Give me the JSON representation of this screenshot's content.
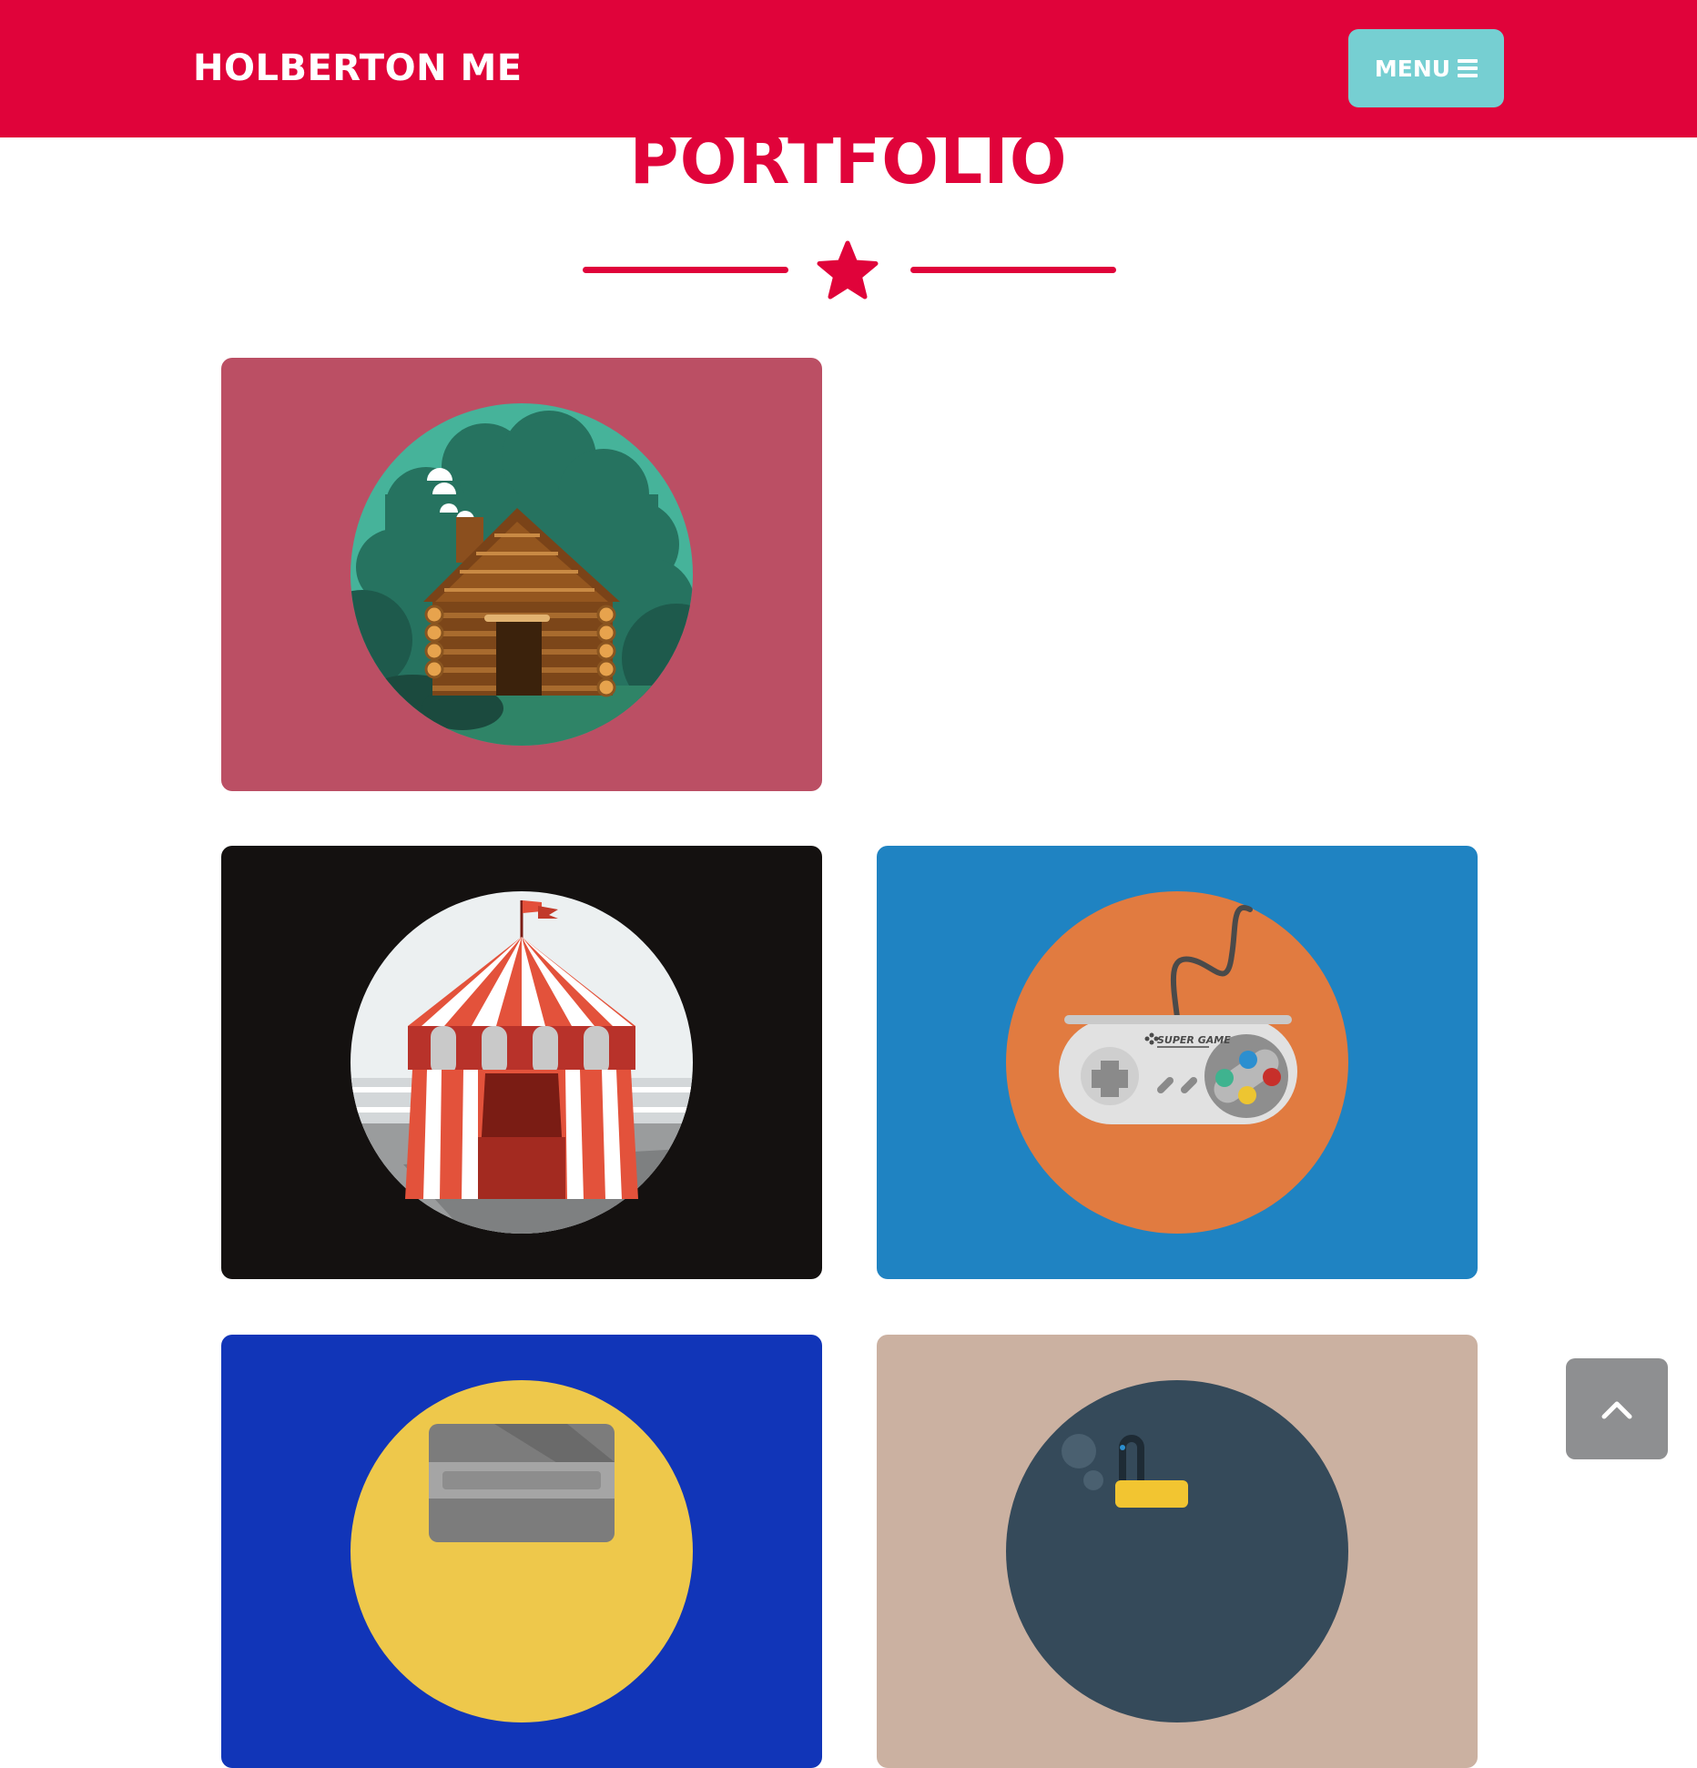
{
  "header": {
    "brand": "HOLBERTON ME",
    "menu_label": "MENU",
    "menu_icon": "bars-icon"
  },
  "portfolio": {
    "title": "PORTFOLIO",
    "divider_icon": "star-icon",
    "items": [
      {
        "name": "log-cabin",
        "background": "#bb4f64",
        "circle": "#46b39a"
      },
      {
        "name": "circus-tent",
        "background": "#141110",
        "circle": "#ecf0f1"
      },
      {
        "name": "game-controller",
        "background": "#1f83c2",
        "circle": "#e17b40",
        "controller_text": "SUPER GAME"
      },
      {
        "name": "safe",
        "background": "#1135b8",
        "circle": "#eec84b"
      },
      {
        "name": "submarine",
        "background": "#cbb1a1",
        "circle": "#354a5a"
      }
    ]
  },
  "scroll_top": {
    "icon": "chevron-up-icon"
  },
  "colors": {
    "brand": "#e0033a",
    "menu": "#76cfd2",
    "scroll_button": "#8e8f91"
  }
}
